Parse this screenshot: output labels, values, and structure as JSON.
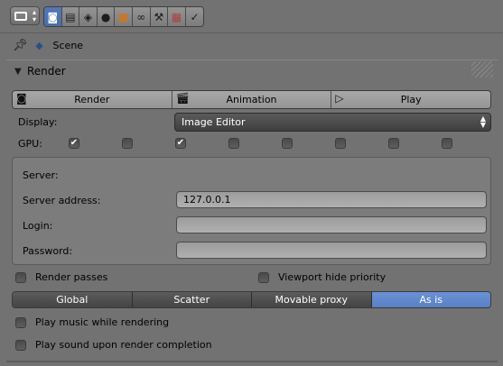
{
  "header": {
    "editor_type_icon": "properties-editor-icon",
    "context_tabs": [
      {
        "icon": "render-camera-icon",
        "active": true
      },
      {
        "icon": "render-layers-icon",
        "active": false
      },
      {
        "icon": "scene-icon",
        "active": false
      },
      {
        "icon": "world-icon",
        "active": false
      },
      {
        "icon": "object-cube-icon",
        "active": false
      },
      {
        "icon": "constraints-link-icon",
        "active": false
      },
      {
        "icon": "modifiers-wrench-icon",
        "active": false
      },
      {
        "icon": "texture-checker-icon",
        "active": false
      },
      {
        "icon": "physics-icon",
        "active": false
      }
    ]
  },
  "breadcrumb": {
    "pin_icon": "pin-icon",
    "scene_icon": "scene-icon",
    "label": "Scene"
  },
  "panel": {
    "title": "Render",
    "buttons": [
      {
        "label": "Render",
        "icon": "render-still-icon"
      },
      {
        "label": "Animation",
        "icon": "clapperboard-icon"
      },
      {
        "label": "Play",
        "icon": "play-icon"
      }
    ],
    "display": {
      "label": "Display:",
      "value": "Image Editor"
    },
    "gpu": {
      "label": "GPU:",
      "checkboxes": [
        true,
        false,
        true,
        false,
        false,
        false,
        false,
        false
      ]
    },
    "server": {
      "heading": "Server:",
      "address_label": "Server address:",
      "address_value": "127.0.0.1",
      "login_label": "Login:",
      "login_value": "",
      "password_label": "Password:",
      "password_value": ""
    },
    "render_passes": {
      "label": "Render passes",
      "checked": false
    },
    "viewport_hide_priority": {
      "label": "Viewport hide priority",
      "checked": false
    },
    "mode_tabs": [
      {
        "label": "Global",
        "active": false
      },
      {
        "label": "Scatter",
        "active": false
      },
      {
        "label": "Movable proxy",
        "active": false
      },
      {
        "label": "As is",
        "active": true
      }
    ],
    "play_music": {
      "label": "Play music while rendering",
      "checked": false
    },
    "play_sound": {
      "label": "Play sound upon render completion",
      "checked": false
    }
  },
  "colors": {
    "background": "#727272",
    "accent_active": "#5b81c4",
    "dropdown": "#4a4a4a"
  }
}
